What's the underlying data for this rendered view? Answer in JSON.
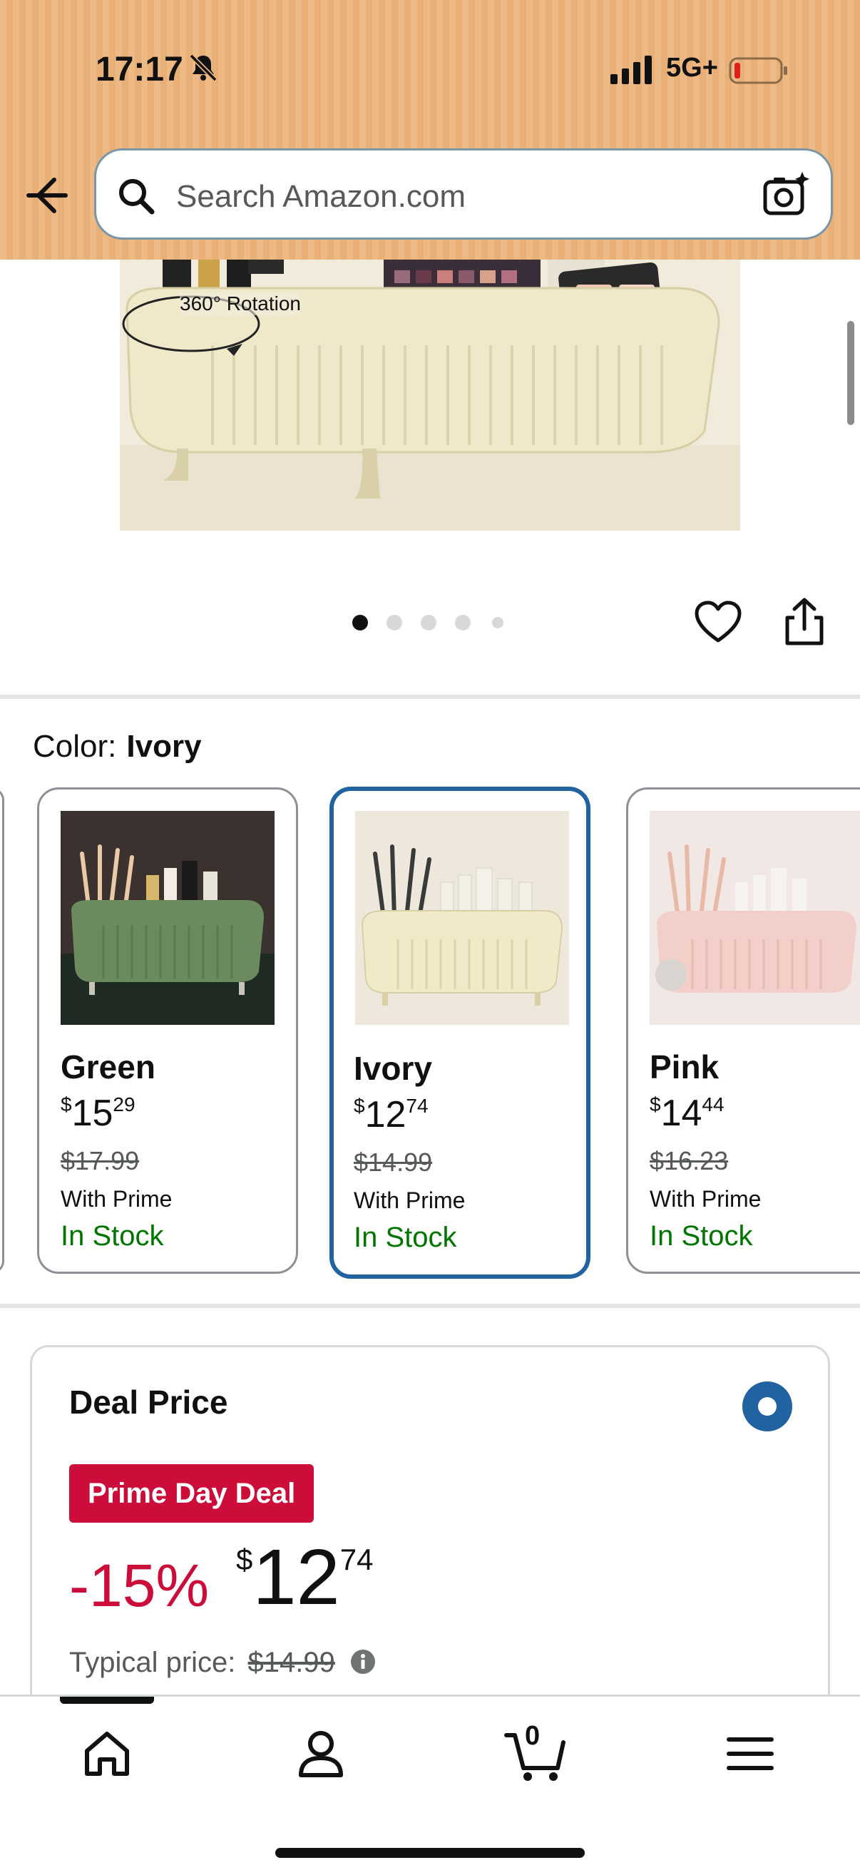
{
  "status_bar": {
    "time": "17:17",
    "network": "5G+"
  },
  "header": {
    "search_placeholder": "Search Amazon.com"
  },
  "hero": {
    "caption": "360° Rotation",
    "image_count": 5,
    "active_index": 0
  },
  "color_selector": {
    "label": "Color:",
    "selected": "Ivory",
    "variants": [
      {
        "name": "Green",
        "price_currency": "$",
        "price_whole": "15",
        "price_cents": "29",
        "list_price": "$17.99",
        "prime": "With Prime",
        "stock": "In Stock"
      },
      {
        "name": "Ivory",
        "price_currency": "$",
        "price_whole": "12",
        "price_cents": "74",
        "list_price": "$14.99",
        "prime": "With Prime",
        "stock": "In Stock"
      },
      {
        "name": "Pink",
        "price_currency": "$",
        "price_whole": "14",
        "price_cents": "44",
        "list_price": "$16.23",
        "prime": "With Prime",
        "stock": "In Stock"
      }
    ]
  },
  "deal": {
    "title": "Deal Price",
    "badge": "Prime Day Deal",
    "discount": "-15%",
    "price_currency": "$",
    "price_whole": "12",
    "price_cents": "74",
    "typical_label": "Typical price:",
    "typical_price": "$14.99"
  },
  "bottom_nav": {
    "items": [
      {
        "icon": "home-icon"
      },
      {
        "icon": "account-icon"
      },
      {
        "icon": "cart-icon",
        "count": "0"
      },
      {
        "icon": "menu-icon"
      }
    ]
  },
  "colors": {
    "header_bg": "#ecb47c",
    "selected_border": "#2162a1",
    "deal_red": "#cc0c39",
    "stock_green": "#007600"
  }
}
